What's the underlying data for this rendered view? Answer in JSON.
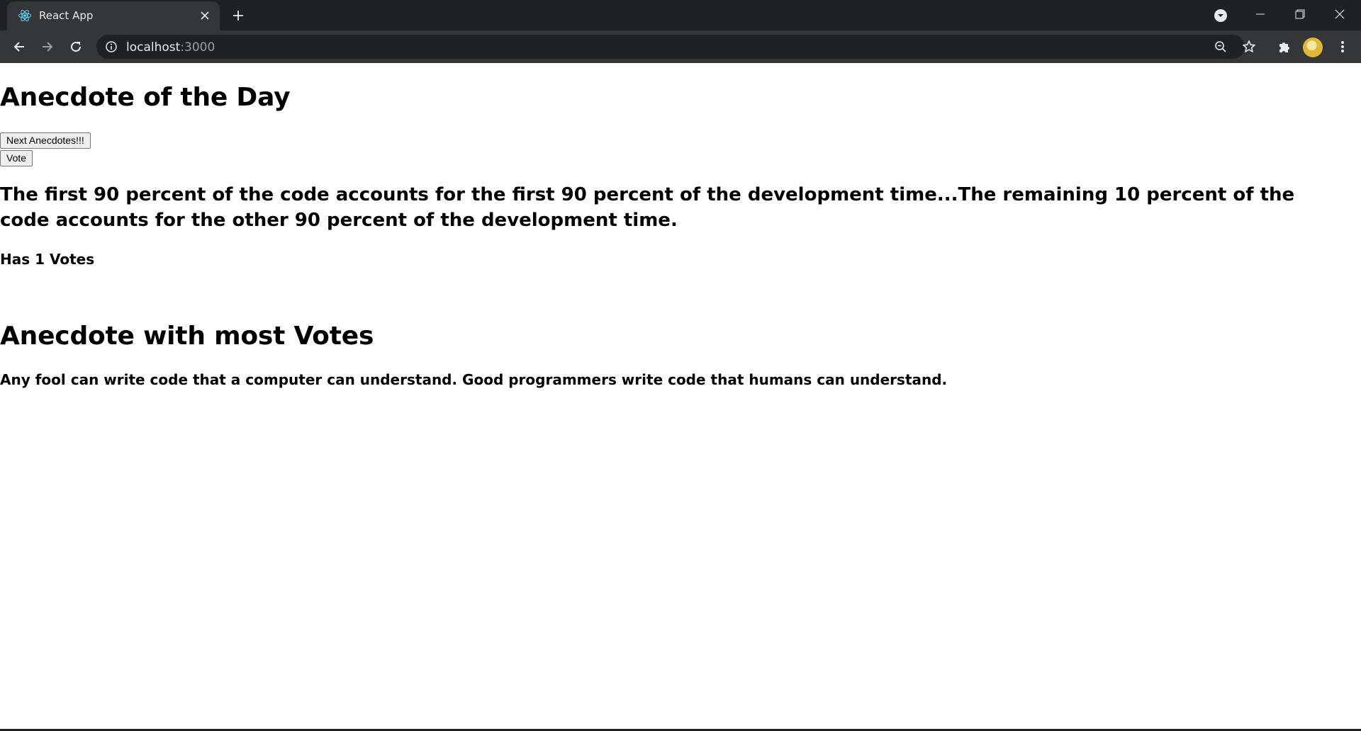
{
  "browser": {
    "tab": {
      "title": "React App",
      "favicon": "react-icon"
    },
    "url": {
      "host": "localhost",
      "port": ":3000"
    },
    "icons": {
      "close": "close-icon",
      "new_tab": "plus-icon",
      "tab_search": "chevron-down-icon",
      "back": "arrow-left-icon",
      "forward": "arrow-right-icon",
      "reload": "reload-icon",
      "info": "info-icon",
      "zoom": "zoom-out-icon",
      "bookmark": "star-icon",
      "extensions": "puzzle-icon",
      "menu": "kebab-menu-icon"
    }
  },
  "page": {
    "title_day": "Anecdote of the Day",
    "next_button": "Next Anecdotes!!!",
    "vote_button": "Vote",
    "anecdote": "The first 90 percent of the code accounts for the first 90 percent of the development time...The remaining 10 percent of the code accounts for the other 90 percent of the development time.",
    "votes_text": "Has 1 Votes",
    "title_most": "Anecdote with most Votes",
    "best_anecdote": "Any fool can write code that a computer can understand. Good programmers write code that humans can understand."
  }
}
